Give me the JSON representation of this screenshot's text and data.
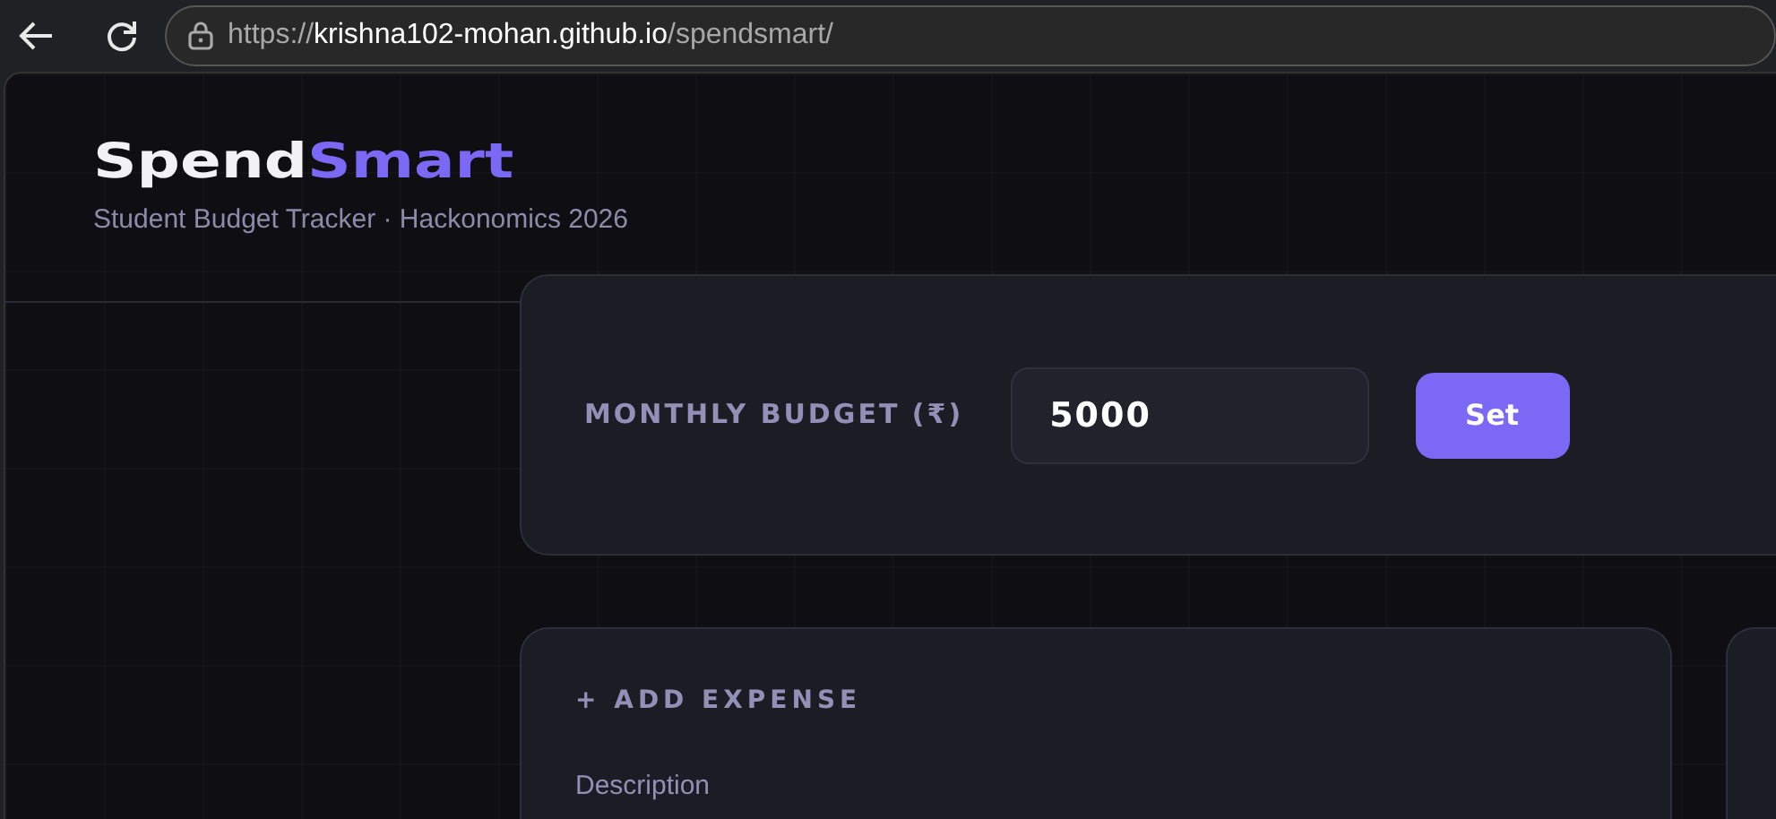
{
  "browser": {
    "url_scheme": "https://",
    "url_host": "krishna102-mohan.github.io",
    "url_path": "/spendsmart/"
  },
  "header": {
    "brand_first": "Spend",
    "brand_second": "Smart",
    "subtitle": "Student Budget Tracker · Hackonomics 2026"
  },
  "budget": {
    "label": "MONTHLY BUDGET (₹)",
    "value": "5000",
    "button": "Set"
  },
  "add_expense": {
    "title": "+ ADD EXPENSE",
    "fields": [
      {
        "label": "Description"
      }
    ]
  }
}
